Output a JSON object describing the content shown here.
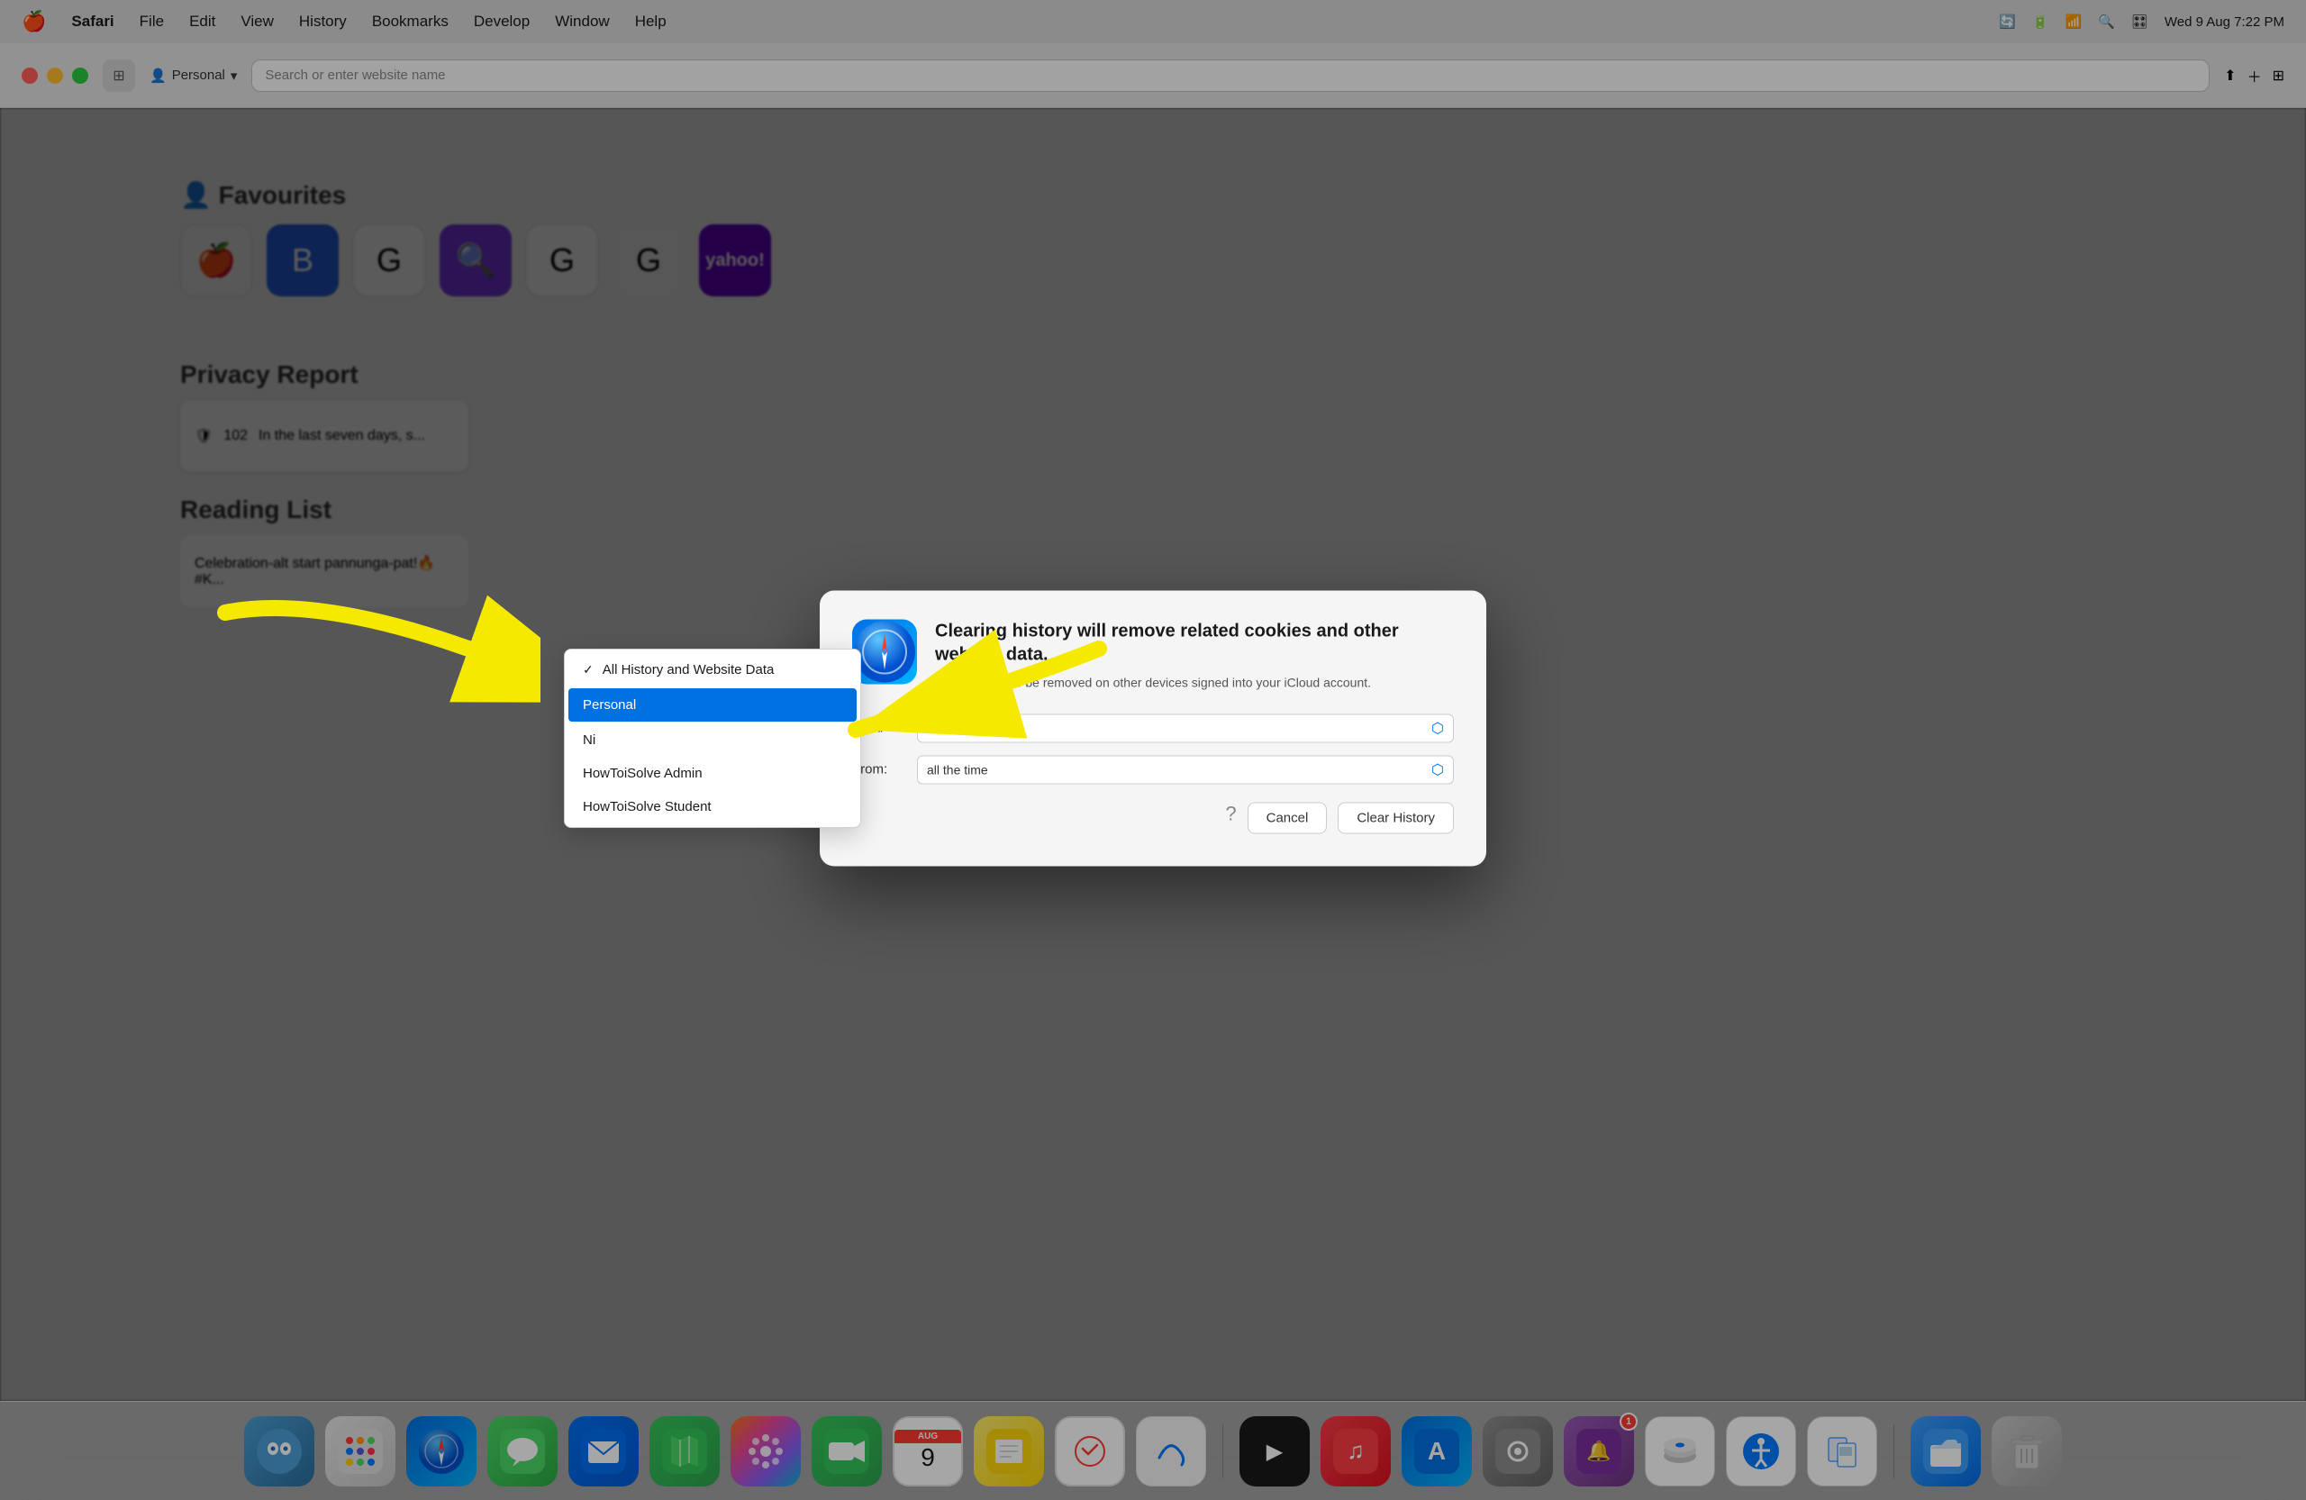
{
  "menubar": {
    "apple": "🍎",
    "items": [
      "Safari",
      "File",
      "Edit",
      "View",
      "History",
      "Bookmarks",
      "Develop",
      "Window",
      "Help"
    ],
    "right": {
      "time": "Wed 9 Aug  7:22 PM"
    }
  },
  "toolbar": {
    "profile": "Personal",
    "address_placeholder": "Search or enter website name"
  },
  "dialog": {
    "title": "Clearing history will remove related cookies and other website data.",
    "subtitle": "History will also be removed on other devices signed into your iCloud account.",
    "clear_label": "Clear",
    "from_label": "From:",
    "clear_select": "All History",
    "from_select": "all the time",
    "cancel_btn": "Cancel",
    "clear_btn": "Clear History"
  },
  "dropdown": {
    "items": [
      {
        "label": "All History and Website Data",
        "checked": true,
        "selected": false
      },
      {
        "label": "Personal",
        "checked": false,
        "selected": true
      },
      {
        "label": "Ni",
        "checked": false,
        "selected": false
      },
      {
        "label": "HowToiSolve Admin",
        "checked": false,
        "selected": false
      },
      {
        "label": "HowToiSolve Student",
        "checked": false,
        "selected": false
      }
    ]
  },
  "favourites": {
    "title": "Favourites",
    "items": [
      "Apple",
      "Blog",
      "Google",
      "Search",
      "Google",
      "Google",
      "Yahoo!"
    ]
  },
  "privacy": {
    "title": "Privacy Report",
    "count": "102",
    "description": "In the last seven days, s..."
  },
  "reading_list": {
    "title": "Reading List",
    "item": "Celebration-alt start pannunga-pat!🔥 #K..."
  },
  "dock": {
    "icons": [
      {
        "name": "finder",
        "emoji": "🖥",
        "bg": "di-finder"
      },
      {
        "name": "launchpad",
        "emoji": "⊞",
        "bg": "di-launchpad"
      },
      {
        "name": "safari",
        "emoji": "🧭",
        "bg": "di-safari"
      },
      {
        "name": "messages",
        "emoji": "💬",
        "bg": "di-messages"
      },
      {
        "name": "mail",
        "emoji": "✉",
        "bg": "di-mail"
      },
      {
        "name": "maps",
        "emoji": "🗺",
        "bg": "di-maps"
      },
      {
        "name": "photos",
        "emoji": "🌸",
        "bg": "di-photos"
      },
      {
        "name": "facetime",
        "emoji": "📹",
        "bg": "di-facetime"
      },
      {
        "name": "calendar",
        "emoji": "9",
        "bg": "di-calendar",
        "badge": "AUG"
      },
      {
        "name": "notes",
        "emoji": "📝",
        "bg": "di-notes"
      },
      {
        "name": "reminders",
        "emoji": "⚪",
        "bg": "di-reminders"
      },
      {
        "name": "freeform",
        "emoji": "✏",
        "bg": "di-freeform"
      },
      {
        "name": "appletv",
        "emoji": "▶",
        "bg": "di-appletv"
      },
      {
        "name": "music",
        "emoji": "♪",
        "bg": "di-music"
      },
      {
        "name": "appstore",
        "emoji": "A",
        "bg": "di-appstore"
      },
      {
        "name": "settings",
        "emoji": "⚙",
        "bg": "di-settings"
      },
      {
        "name": "notif",
        "emoji": "🔔",
        "bg": "di-notif",
        "badge": "1"
      },
      {
        "name": "diskutil",
        "emoji": "💿",
        "bg": "di-diskutil"
      },
      {
        "name": "accessibility",
        "emoji": "♿",
        "bg": "di-accessibility"
      },
      {
        "name": "preview",
        "emoji": "👁",
        "bg": "di-preview"
      },
      {
        "name": "files",
        "emoji": "📁",
        "bg": "di-files"
      },
      {
        "name": "trash",
        "emoji": "🗑",
        "bg": "di-trash"
      }
    ]
  }
}
